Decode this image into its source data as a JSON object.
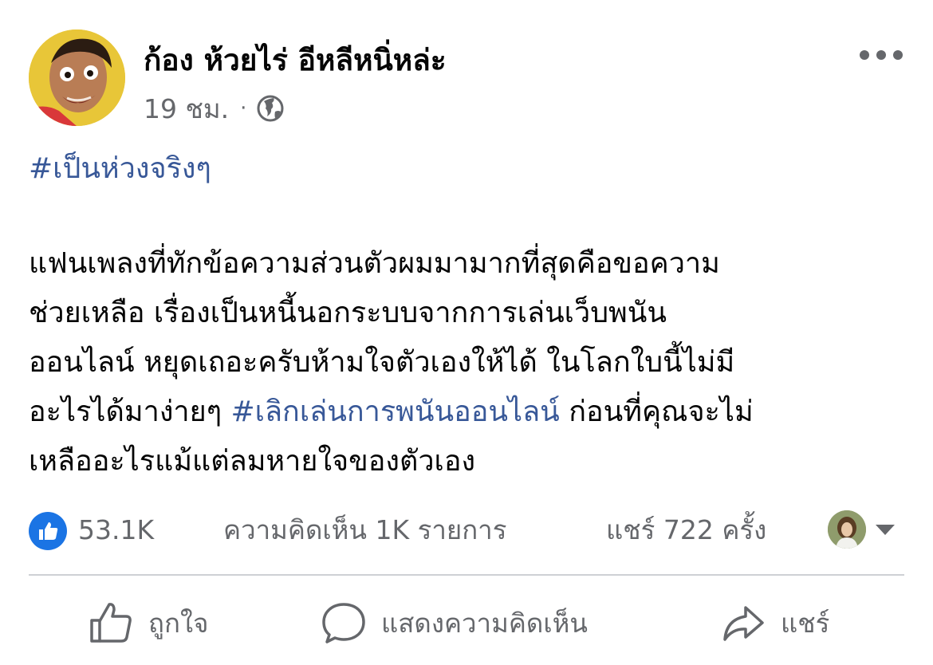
{
  "post": {
    "author": "ก้อง ห้วยไร่ อีหลีหนิ่หล่ะ",
    "time": "19 ชม.",
    "separator": "·",
    "privacy_icon": "globe-icon",
    "more_icon": "ellipsis-icon",
    "hashtag_top": "#เป็นห่วงจริงๆ",
    "body_lines": [
      "แฟนเพลงที่ทักข้อความส่วนตัวผมมามากที่สุดคือขอความ",
      "ช่วยเหลือ เรื่องเป็นหนี้นอกระบบจากการเล่นเว็บพนัน",
      "ออนไลน์ หยุดเถอะครับห้ามใจตัวเองให้ได้ ในโลกใบนี้ไม่มี",
      "อะไรได้มาง่ายๆ",
      "#เลิกเล่นการพนันออนไลน์",
      "ก่อนที่คุณจะไม่",
      "เหลืออะไรแม้แต่ลมหายใจของตัวเอง"
    ],
    "hashtag_color": "#385898"
  },
  "stats": {
    "likes": "53.1K",
    "comments": "ความคิดเห็น 1K รายการ",
    "shares": "แชร์ 722 ครั้ง",
    "like_badge_color": "#1b74e4"
  },
  "actions": {
    "like": "ถูกใจ",
    "comment": "แสดงความคิดเห็น",
    "share": "แชร์"
  }
}
